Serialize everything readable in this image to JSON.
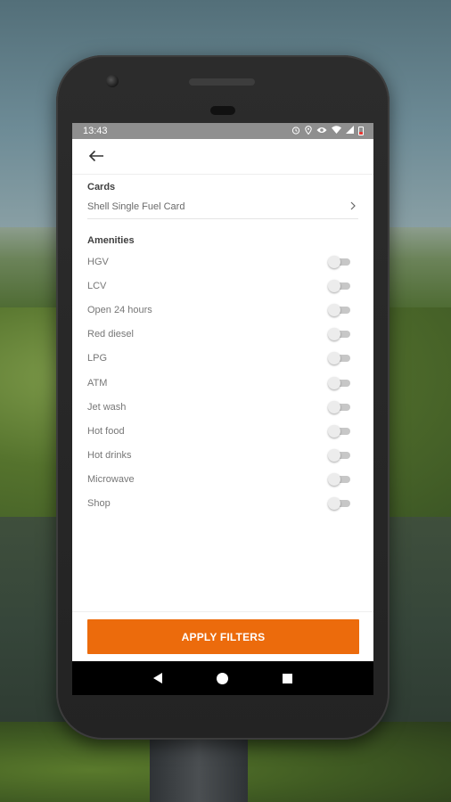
{
  "status_bar": {
    "time": "13:43",
    "icons": [
      "alarm-icon",
      "location-icon",
      "eye-icon",
      "wifi-icon",
      "signal-icon",
      "battery-low-icon"
    ]
  },
  "app_bar": {
    "back_icon": "arrow-left-icon"
  },
  "cards": {
    "label": "Cards",
    "value": "Shell Single Fuel Card"
  },
  "amenities": {
    "label": "Amenities",
    "items": [
      {
        "label": "HGV",
        "on": false
      },
      {
        "label": "LCV",
        "on": false
      },
      {
        "label": "Open 24 hours",
        "on": false
      },
      {
        "label": "Red diesel",
        "on": false
      },
      {
        "label": "LPG",
        "on": false
      },
      {
        "label": "ATM",
        "on": false
      },
      {
        "label": "Jet wash",
        "on": false
      },
      {
        "label": "Hot food",
        "on": false
      },
      {
        "label": "Hot drinks",
        "on": false
      },
      {
        "label": "Microwave",
        "on": false
      },
      {
        "label": "Shop",
        "on": false
      }
    ]
  },
  "apply_button": {
    "label": "APPLY FILTERS",
    "color": "#ec6b0c"
  },
  "nav_bar": {
    "icons": [
      "nav-back-icon",
      "nav-home-icon",
      "nav-recents-icon"
    ]
  }
}
